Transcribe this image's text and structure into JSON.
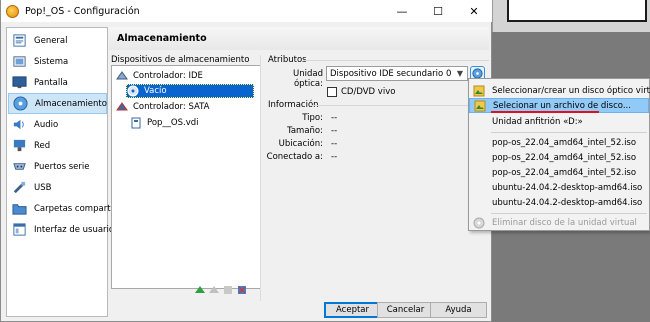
{
  "window": {
    "title": "Pop!_OS - Configuración",
    "minimize": "—",
    "maximize": "☐",
    "close": "✕"
  },
  "sidebar": {
    "items": [
      {
        "label": "General",
        "icon": "general-icon"
      },
      {
        "label": "Sistema",
        "icon": "system-icon"
      },
      {
        "label": "Pantalla",
        "icon": "display-icon"
      },
      {
        "label": "Almacenamiento",
        "icon": "storage-icon",
        "selected": true
      },
      {
        "label": "Audio",
        "icon": "audio-icon"
      },
      {
        "label": "Red",
        "icon": "network-icon"
      },
      {
        "label": "Puertos serie",
        "icon": "serial-ports-icon"
      },
      {
        "label": "USB",
        "icon": "usb-icon"
      },
      {
        "label": "Carpetas compartidas",
        "icon": "shared-folders-icon"
      },
      {
        "label": "Interfaz de usuario",
        "icon": "user-interface-icon"
      }
    ]
  },
  "page": {
    "title": "Almacenamiento"
  },
  "devices": {
    "group_title": "Dispositivos de almacenamiento",
    "tree": [
      {
        "label": "Controlador: IDE",
        "type": "controller-ide"
      },
      {
        "label": "Vacío",
        "type": "optical-empty",
        "selected": true
      },
      {
        "label": "Controlador: SATA",
        "type": "controller-sata"
      },
      {
        "label": "Pop__OS.vdi",
        "type": "hard-disk"
      }
    ]
  },
  "attributes": {
    "group_title": "Atributos",
    "optical_drive_label": "Unidad óptica:",
    "optical_drive_value": "Dispositivo IDE secundario 0",
    "live_cd_label": "CD/DVD vivo"
  },
  "information": {
    "group_title": "Información",
    "rows": [
      {
        "label": "Tipo:",
        "value": "--"
      },
      {
        "label": "Tamaño:",
        "value": "--"
      },
      {
        "label": "Ubicación:",
        "value": "--"
      },
      {
        "label": "Conectado a:",
        "value": "--"
      }
    ]
  },
  "buttons": {
    "accept": "Aceptar",
    "cancel": "Cancelar",
    "help": "Ayuda"
  },
  "menu": {
    "items": [
      {
        "label": "Seleccionar/crear un disco óptico virtual...",
        "icon": "disc-image-icon"
      },
      {
        "label": "Selecionar un archivo de disco...",
        "icon": "disc-image-icon",
        "highlighted": true
      },
      {
        "label": "Unidad anfitrión «D:»"
      },
      {
        "label": "pop-os_22.04_amd64_intel_52.iso"
      },
      {
        "label": "pop-os_22.04_amd64_intel_52.iso"
      },
      {
        "label": "pop-os_22.04_amd64_intel_52.iso"
      },
      {
        "label": "ubuntu-24.04.2-desktop-amd64.iso"
      },
      {
        "label": "ubuntu-24.04.2-desktop-amd64.iso"
      },
      {
        "label": "Eliminar disco de la unidad virtual",
        "disabled": true
      }
    ]
  },
  "colors": {
    "selection_blue": "#0a64d0",
    "highlight_red": "#e01020",
    "menu_highlight": "#91c9f7"
  }
}
